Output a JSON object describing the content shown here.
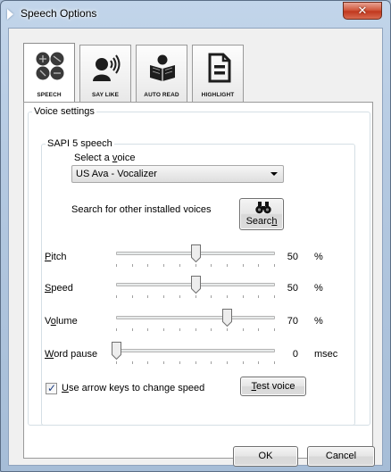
{
  "window": {
    "title": "Speech Options",
    "close_glyph": "✕"
  },
  "tabs": [
    {
      "label": "SPEECH",
      "icon": "speech-dots-icon",
      "active": true
    },
    {
      "label": "SAY LIKE",
      "icon": "speaking-head-icon",
      "active": false
    },
    {
      "label": "AUTO READ",
      "icon": "reader-book-icon",
      "active": false
    },
    {
      "label": "HIGHLIGHT",
      "icon": "document-lines-icon",
      "active": false
    }
  ],
  "voice_settings": {
    "group_label": "Voice settings",
    "sapi_label": "SAPI 5 speech",
    "select_voice_label_pre": "Select a ",
    "select_voice_label_u": "v",
    "select_voice_label_post": "oice",
    "selected_voice": "US Ava - Vocalizer",
    "search_prompt": "Search for other installed voices",
    "search_button_pre": "Searc",
    "search_button_u": "h",
    "search_button_post": ""
  },
  "sliders": {
    "pitch": {
      "label_u": "P",
      "label_rest": "itch",
      "value": "50",
      "unit": "%",
      "position": 0.5
    },
    "speed": {
      "label_u": "S",
      "label_rest": "peed",
      "value": "50",
      "unit": "%",
      "position": 0.5
    },
    "volume": {
      "label_pre": "V",
      "label_u": "o",
      "label_rest": "lume",
      "value": "70",
      "unit": "%",
      "position": 0.7
    },
    "word_pause": {
      "label_u": "W",
      "label_rest": "ord pause",
      "value": "0",
      "unit": "msec",
      "position": 0.0
    }
  },
  "arrow_keys": {
    "checked": true,
    "label_u": "U",
    "label_rest": "se arrow keys to change speed"
  },
  "test_voice": {
    "label_u": "T",
    "label_rest": "est voice"
  },
  "footer": {
    "ok_label": "OK",
    "cancel_label": "Cancel"
  },
  "colors": {
    "accent_blue": "#1b3c82",
    "close_red": "#c1381e"
  }
}
